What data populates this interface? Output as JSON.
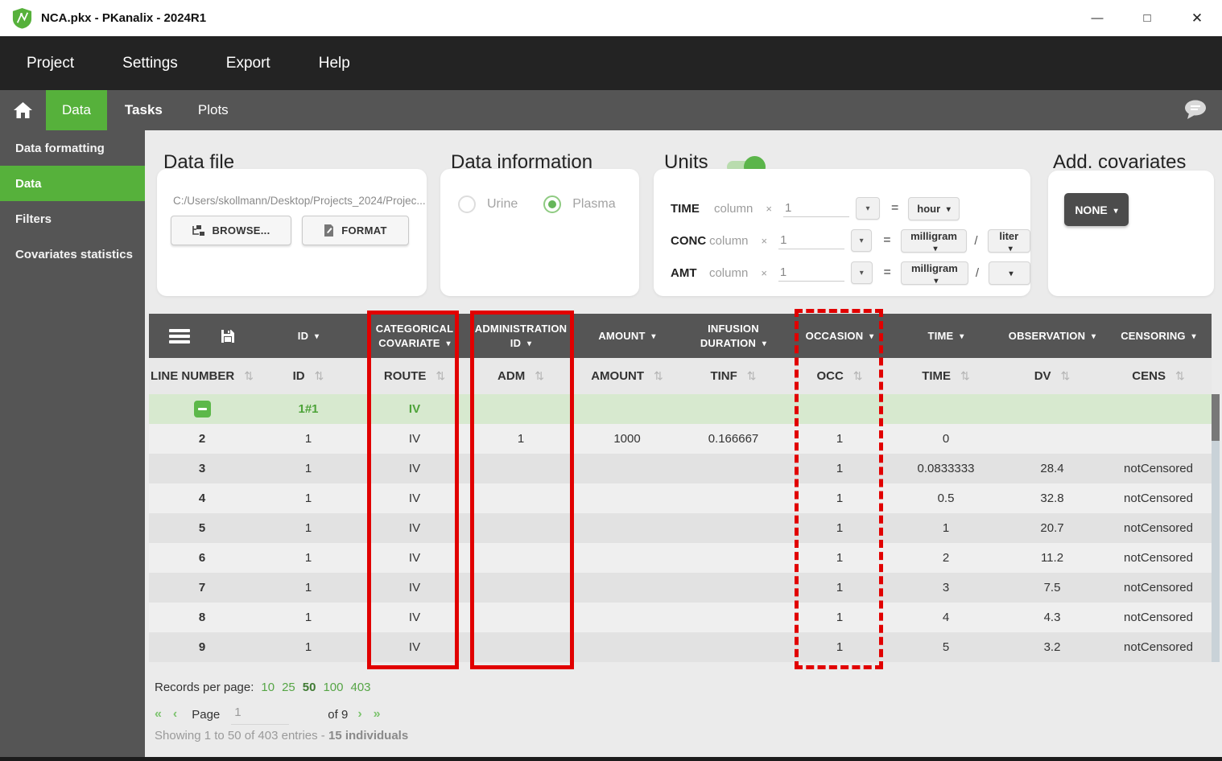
{
  "window": {
    "title": "NCA.pkx - PKanalix - 2024R1",
    "minimize": "—",
    "maximize": "□",
    "close": "✕"
  },
  "menu": {
    "items": [
      "Project",
      "Settings",
      "Export",
      "Help"
    ]
  },
  "tabs": {
    "items": [
      {
        "label": "Data",
        "active": true,
        "bold": false
      },
      {
        "label": "Tasks",
        "active": false,
        "bold": true
      },
      {
        "label": "Plots",
        "active": false,
        "bold": false
      }
    ]
  },
  "sidebar": {
    "items": [
      {
        "label": "Data formatting",
        "active": false
      },
      {
        "label": "Data",
        "active": true
      },
      {
        "label": "Filters",
        "active": false
      },
      {
        "label": "Covariates statistics",
        "active": false
      }
    ]
  },
  "panels": {
    "data_file": {
      "title": "Data file",
      "path": "C:/Users/skollmann/Desktop/Projects_2024/Projec...",
      "browse_label": "BROWSE...",
      "format_label": "FORMAT"
    },
    "data_information": {
      "title": "Data information",
      "options": [
        {
          "label": "Urine",
          "selected": false
        },
        {
          "label": "Plasma",
          "selected": true
        }
      ]
    },
    "units": {
      "title": "Units",
      "toggle_on": true,
      "times_symbol": "×",
      "equals_symbol": "=",
      "slash_symbol": "/",
      "rows": [
        {
          "label": "TIME",
          "column_text": "column",
          "multiplier": "1",
          "unit": "hour",
          "denominator": null
        },
        {
          "label": "CONC",
          "column_text": "column",
          "multiplier": "1",
          "unit": "milligram",
          "denominator": "liter"
        },
        {
          "label": "AMT",
          "column_text": "column",
          "multiplier": "1",
          "unit": "milligram",
          "denominator": ""
        }
      ]
    },
    "add_covariates": {
      "title": "Add. covariates",
      "button_label": "NONE"
    }
  },
  "table": {
    "type_headers": [
      "",
      "ID",
      "CATEGORICAL\nCOVARIATE",
      "ADMINISTRATION\nID",
      "AMOUNT",
      "INFUSION\nDURATION",
      "OCCASION",
      "TIME",
      "OBSERVATION",
      "CENSORING"
    ],
    "column_headers": [
      "LINE NUMBER",
      "ID",
      "ROUTE",
      "ADM",
      "AMOUNT",
      "TINF",
      "OCC",
      "TIME",
      "DV",
      "CENS"
    ],
    "rows": [
      {
        "collapse_icon": true,
        "highlight": true,
        "cells": [
          "",
          "1#1",
          "IV",
          "",
          "",
          "",
          "",
          "",
          "",
          ""
        ]
      },
      {
        "collapse_icon": false,
        "highlight": false,
        "cells": [
          "2",
          "1",
          "IV",
          "1",
          "1000",
          "0.166667",
          "1",
          "0",
          "",
          ""
        ]
      },
      {
        "collapse_icon": false,
        "highlight": false,
        "cells": [
          "3",
          "1",
          "IV",
          "",
          "",
          "",
          "1",
          "0.0833333",
          "28.4",
          "notCensored"
        ]
      },
      {
        "collapse_icon": false,
        "highlight": false,
        "cells": [
          "4",
          "1",
          "IV",
          "",
          "",
          "",
          "1",
          "0.5",
          "32.8",
          "notCensored"
        ]
      },
      {
        "collapse_icon": false,
        "highlight": false,
        "cells": [
          "5",
          "1",
          "IV",
          "",
          "",
          "",
          "1",
          "1",
          "20.7",
          "notCensored"
        ]
      },
      {
        "collapse_icon": false,
        "highlight": false,
        "cells": [
          "6",
          "1",
          "IV",
          "",
          "",
          "",
          "1",
          "2",
          "11.2",
          "notCensored"
        ]
      },
      {
        "collapse_icon": false,
        "highlight": false,
        "cells": [
          "7",
          "1",
          "IV",
          "",
          "",
          "",
          "1",
          "3",
          "7.5",
          "notCensored"
        ]
      },
      {
        "collapse_icon": false,
        "highlight": false,
        "cells": [
          "8",
          "1",
          "IV",
          "",
          "",
          "",
          "1",
          "4",
          "4.3",
          "notCensored"
        ]
      },
      {
        "collapse_icon": false,
        "highlight": false,
        "cells": [
          "9",
          "1",
          "IV",
          "",
          "",
          "",
          "1",
          "5",
          "3.2",
          "notCensored"
        ]
      }
    ]
  },
  "pagination": {
    "records_label": "Records per page:",
    "options": [
      "10",
      "25",
      "50",
      "100",
      "403"
    ],
    "selected": "50",
    "first": "«",
    "prev": "‹",
    "page_label": "Page",
    "page_value": "1",
    "of_label": "of 9",
    "next": "›",
    "last": "»",
    "summary": "Showing 1 to 50 of 403 entries - ",
    "summary_bold": "15 individuals"
  },
  "icons": {
    "sort": "⇅",
    "caret_down": "▾"
  },
  "colors": {
    "accent_green": "#56b13b",
    "row_highlight": "#d7e9cf",
    "annotation_red": "#e10000",
    "header_dark": "#555555"
  }
}
